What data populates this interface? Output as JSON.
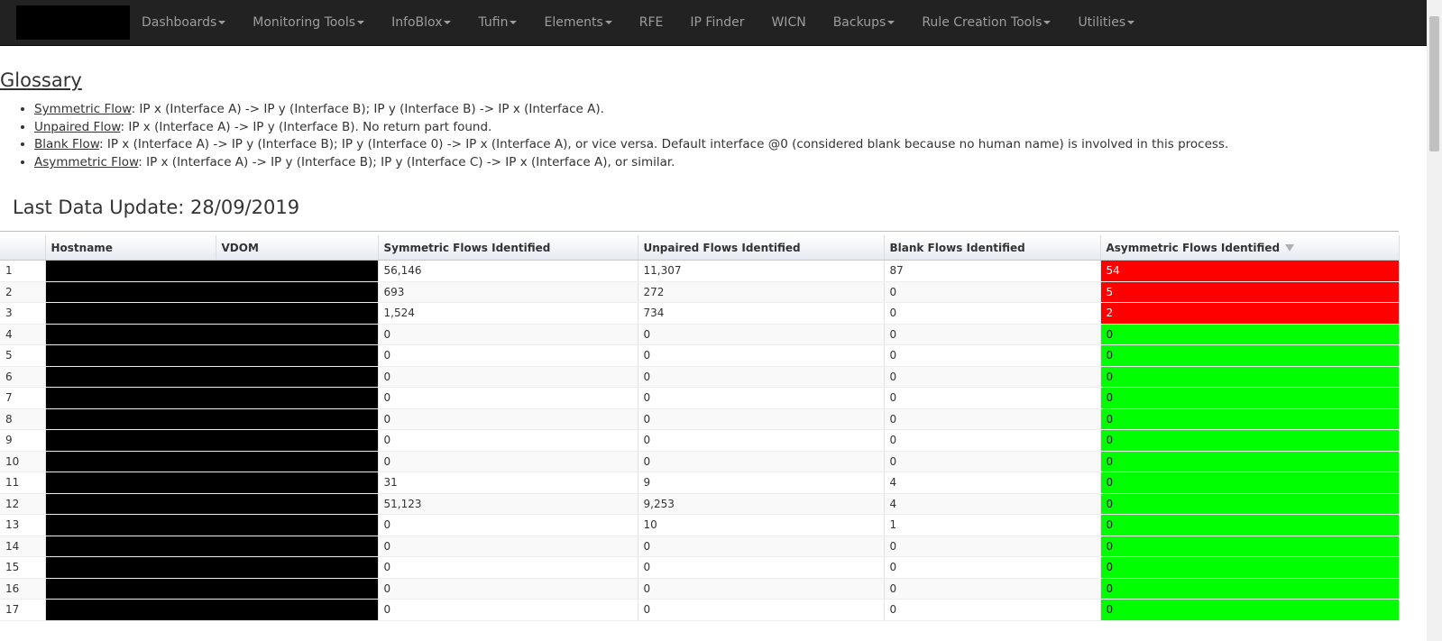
{
  "navbar": {
    "items": [
      {
        "label": "Dashboards",
        "dropdown": true
      },
      {
        "label": "Monitoring Tools",
        "dropdown": true
      },
      {
        "label": "InfoBlox",
        "dropdown": true
      },
      {
        "label": "Tufin",
        "dropdown": true
      },
      {
        "label": "Elements",
        "dropdown": true
      },
      {
        "label": "RFE",
        "dropdown": false
      },
      {
        "label": "IP Finder",
        "dropdown": false
      },
      {
        "label": "WICN",
        "dropdown": false
      },
      {
        "label": "Backups",
        "dropdown": true
      },
      {
        "label": "Rule Creation Tools",
        "dropdown": true
      },
      {
        "label": "Utilities",
        "dropdown": true
      }
    ]
  },
  "glossary": {
    "title": "Glossary",
    "items": [
      {
        "term": "Symmetric Flow",
        "desc": ": IP x (Interface A) -> IP y (Interface B); IP y (Interface B) -> IP x (Interface A)."
      },
      {
        "term": "Unpaired Flow",
        "desc": ": IP x (Interface A) -> IP y (Interface B). No return part found."
      },
      {
        "term": "Blank Flow",
        "desc": ": IP x (Interface A) -> IP y (Interface B); IP y (Interface 0) -> IP x (Interface A), or vice versa. Default interface @0 (considered blank because no human name) is involved in this process."
      },
      {
        "term": "Asymmetric Flow",
        "desc": ": IP x (Interface A) -> IP y (Interface B); IP y (Interface C) -> IP x (Interface A), or similar."
      }
    ]
  },
  "last_update": "Last Data Update: 28/09/2019",
  "table": {
    "columns": [
      "",
      "Hostname",
      "VDOM",
      "Symmetric Flows Identified",
      "Unpaired Flows Identified",
      "Blank Flows Identified",
      "Asymmetric Flows Identified"
    ],
    "sort_column": "Asymmetric Flows Identified",
    "colors": {
      "alert": "#ff0000",
      "ok": "#00ff00"
    },
    "rows": [
      {
        "n": "1",
        "symmetric": "56,146",
        "unpaired": "11,307",
        "blank": "87",
        "asymmetric": "54",
        "status": "alert"
      },
      {
        "n": "2",
        "symmetric": "693",
        "unpaired": "272",
        "blank": "0",
        "asymmetric": "5",
        "status": "alert"
      },
      {
        "n": "3",
        "symmetric": "1,524",
        "unpaired": "734",
        "blank": "0",
        "asymmetric": "2",
        "status": "alert"
      },
      {
        "n": "4",
        "symmetric": "0",
        "unpaired": "0",
        "blank": "0",
        "asymmetric": "0",
        "status": "ok"
      },
      {
        "n": "5",
        "symmetric": "0",
        "unpaired": "0",
        "blank": "0",
        "asymmetric": "0",
        "status": "ok"
      },
      {
        "n": "6",
        "symmetric": "0",
        "unpaired": "0",
        "blank": "0",
        "asymmetric": "0",
        "status": "ok"
      },
      {
        "n": "7",
        "symmetric": "0",
        "unpaired": "0",
        "blank": "0",
        "asymmetric": "0",
        "status": "ok"
      },
      {
        "n": "8",
        "symmetric": "0",
        "unpaired": "0",
        "blank": "0",
        "asymmetric": "0",
        "status": "ok"
      },
      {
        "n": "9",
        "symmetric": "0",
        "unpaired": "0",
        "blank": "0",
        "asymmetric": "0",
        "status": "ok"
      },
      {
        "n": "10",
        "symmetric": "0",
        "unpaired": "0",
        "blank": "0",
        "asymmetric": "0",
        "status": "ok"
      },
      {
        "n": "11",
        "symmetric": "31",
        "unpaired": "9",
        "blank": "4",
        "asymmetric": "0",
        "status": "ok"
      },
      {
        "n": "12",
        "symmetric": "51,123",
        "unpaired": "9,253",
        "blank": "4",
        "asymmetric": "0",
        "status": "ok"
      },
      {
        "n": "13",
        "symmetric": "0",
        "unpaired": "10",
        "blank": "1",
        "asymmetric": "0",
        "status": "ok"
      },
      {
        "n": "14",
        "symmetric": "0",
        "unpaired": "0",
        "blank": "0",
        "asymmetric": "0",
        "status": "ok"
      },
      {
        "n": "15",
        "symmetric": "0",
        "unpaired": "0",
        "blank": "0",
        "asymmetric": "0",
        "status": "ok"
      },
      {
        "n": "16",
        "symmetric": "0",
        "unpaired": "0",
        "blank": "0",
        "asymmetric": "0",
        "status": "ok"
      },
      {
        "n": "17",
        "symmetric": "0",
        "unpaired": "0",
        "blank": "0",
        "asymmetric": "0",
        "status": "ok"
      }
    ]
  }
}
